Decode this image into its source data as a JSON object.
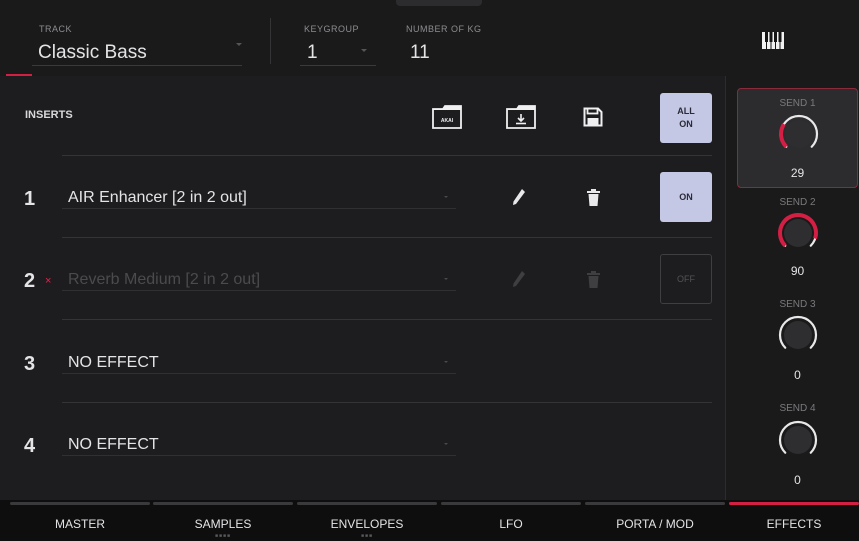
{
  "header": {
    "track": {
      "label": "TRACK",
      "value": "Classic Bass"
    },
    "keygroup": {
      "label": "KEYGROUP",
      "value": "1"
    },
    "number_of_kg": {
      "label": "NUMBER OF KG",
      "value": "11"
    },
    "keyboard_icon": "piano-keys-icon"
  },
  "inserts": {
    "title": "INSERTS",
    "toolbar": {
      "akai_icon_text": "AKAI",
      "all_on": {
        "line1": "ALL",
        "line2": "ON"
      }
    },
    "slots": [
      {
        "number": "1",
        "name": "AIR Enhancer [2 in 2 out]",
        "bypass": "",
        "toggle": "ON",
        "active": true
      },
      {
        "number": "2",
        "name": "Reverb Medium [2 in 2 out]",
        "bypass": "×",
        "toggle": "OFF",
        "active": false
      },
      {
        "number": "3",
        "name": "NO EFFECT",
        "bypass": "",
        "toggle": "",
        "active": false
      },
      {
        "number": "4",
        "name": "NO EFFECT",
        "bypass": "",
        "toggle": "",
        "active": false
      }
    ]
  },
  "sends": [
    {
      "label": "SEND 1",
      "value": "29",
      "level": 29
    },
    {
      "label": "SEND 2",
      "value": "90",
      "level": 90
    },
    {
      "label": "SEND 3",
      "value": "0",
      "level": 0
    },
    {
      "label": "SEND 4",
      "value": "0",
      "level": 0
    }
  ],
  "tabs": [
    {
      "label": "MASTER",
      "dots": ""
    },
    {
      "label": "SAMPLES",
      "dots": "■■■■"
    },
    {
      "label": "ENVELOPES",
      "dots": "■■■"
    },
    {
      "label": "LFO",
      "dots": ""
    },
    {
      "label": "PORTA / MOD",
      "dots": ""
    },
    {
      "label": "EFFECTS",
      "dots": ""
    }
  ],
  "colors": {
    "accent": "#d41f45",
    "button_on": "#c5c8e4",
    "knob_ring": "#e8e8ea",
    "knob_track": "#2e2e30"
  }
}
